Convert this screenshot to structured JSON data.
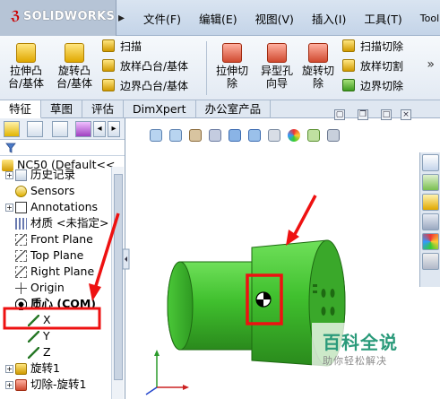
{
  "title_bar": {
    "logo_text": "SOLIDWORKS",
    "menu": [
      "文件(F)",
      "编辑(E)",
      "视图(V)",
      "插入(I)",
      "工具(T)",
      "Toolbox"
    ]
  },
  "ribbon": {
    "big_buttons": [
      {
        "label": "拉伸凸\n台/基体"
      },
      {
        "label": "旋转凸\n台/基体"
      },
      {
        "label": "拉伸切\n除"
      },
      {
        "label": "异型孔\n向导"
      },
      {
        "label": "旋转切\n除"
      }
    ],
    "small_left": [
      "扫描",
      "放样凸台/基体",
      "边界凸台/基体"
    ],
    "small_right": [
      "扫描切除",
      "放样切割",
      "边界切除"
    ],
    "more_icon": "double-chevron-right"
  },
  "tabs": [
    "特征",
    "草图",
    "评估",
    "DimXpert",
    "办公室产品"
  ],
  "active_tab": "特征",
  "feature_tree": {
    "root": "NC50  (Default<<",
    "items": [
      {
        "label": "历史记录",
        "icon": "history-icon",
        "expand": "+"
      },
      {
        "label": "Sensors",
        "icon": "sensor-icon",
        "expand": ""
      },
      {
        "label": "Annotations",
        "icon": "annotation-icon",
        "expand": "+"
      },
      {
        "label": "材质 <未指定>",
        "icon": "material-icon",
        "expand": ""
      },
      {
        "label": "Front Plane",
        "icon": "plane-icon",
        "expand": ""
      },
      {
        "label": "Top Plane",
        "icon": "plane-icon",
        "expand": ""
      },
      {
        "label": "Right Plane",
        "icon": "plane-icon",
        "expand": ""
      },
      {
        "label": "Origin",
        "icon": "origin-icon",
        "expand": ""
      },
      {
        "label": "质心 (COM)",
        "icon": "com-icon",
        "expand": ""
      },
      {
        "label": "X",
        "icon": "axis-icon",
        "expand": ""
      },
      {
        "label": "Y",
        "icon": "axis-icon",
        "expand": ""
      },
      {
        "label": "Z",
        "icon": "axis-icon",
        "expand": ""
      },
      {
        "label": "旋转1",
        "icon": "revolve-icon",
        "expand": "+"
      },
      {
        "label": "切除-旋转1",
        "icon": "cut-icon",
        "expand": "+"
      }
    ]
  },
  "colors": {
    "part_green": "#3fbf2f",
    "highlight_red": "#ee1111",
    "watermark_green": "#2a9a7a"
  },
  "watermark": {
    "title": "百科全说",
    "subtitle": "助你轻松解决"
  }
}
